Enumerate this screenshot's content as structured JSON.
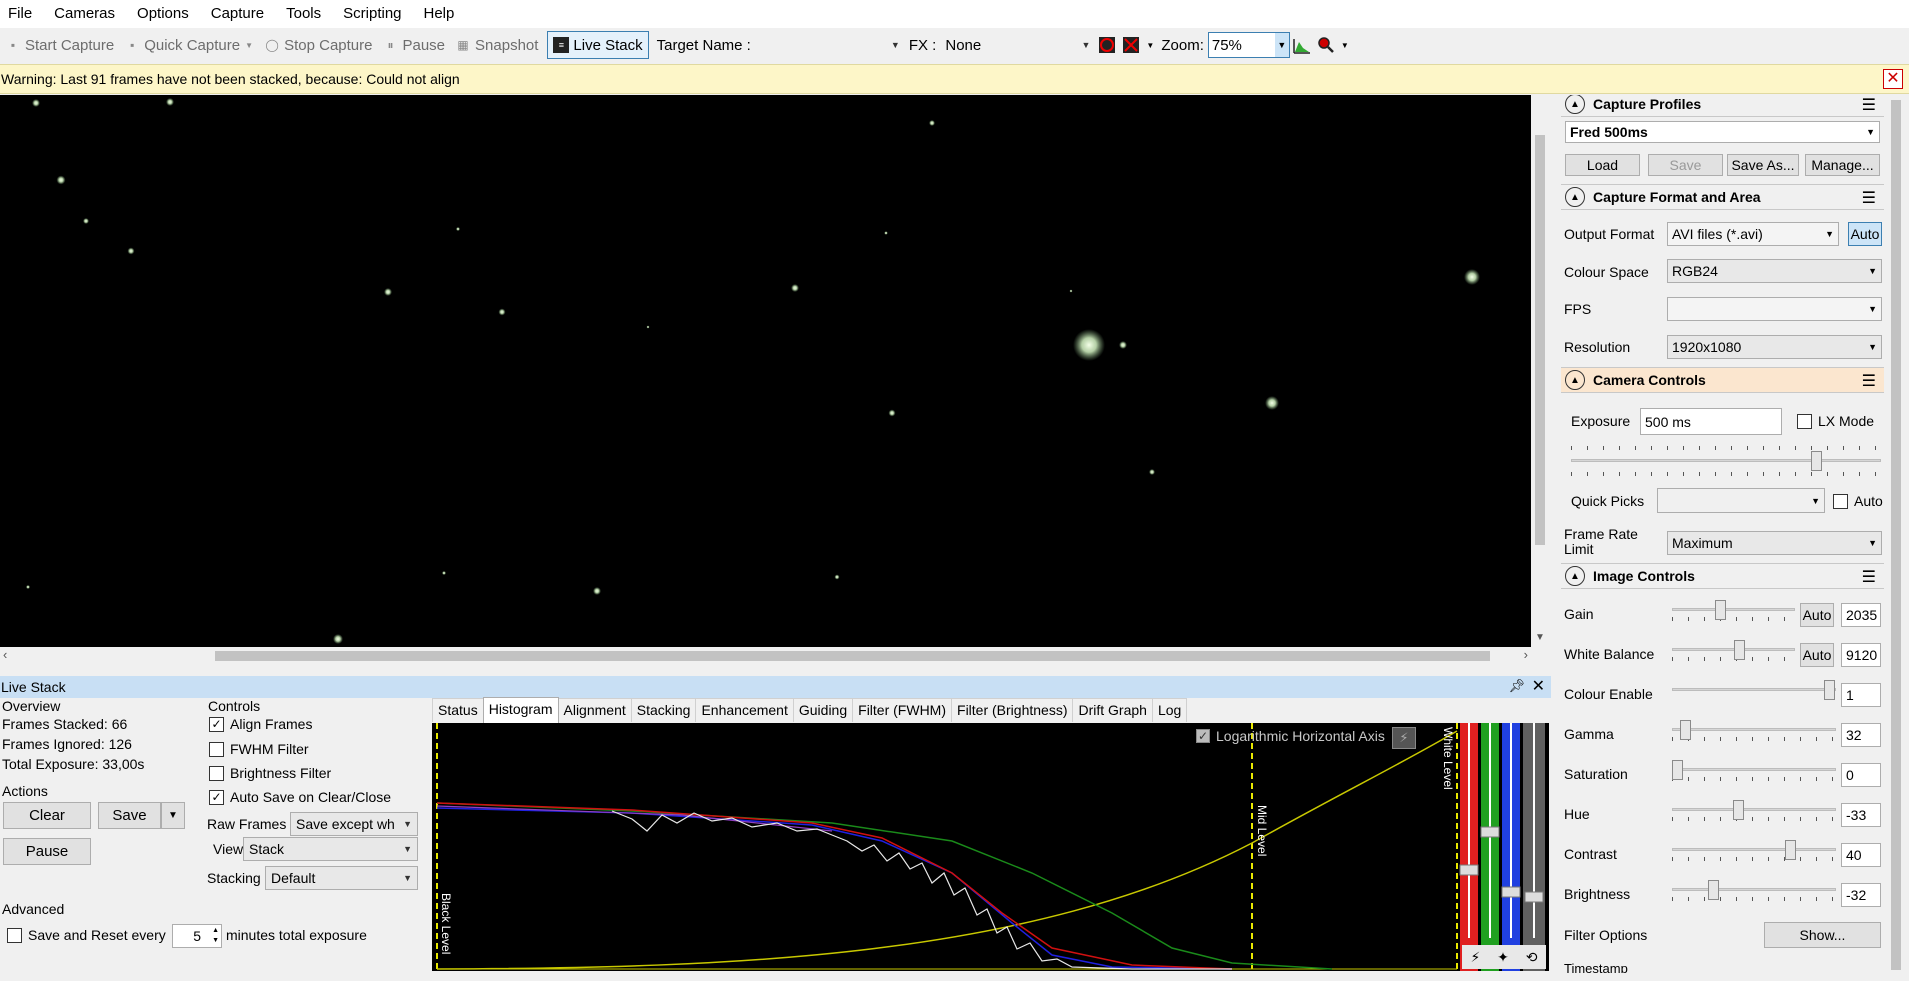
{
  "menu": [
    "File",
    "Cameras",
    "Options",
    "Capture",
    "Tools",
    "Scripting",
    "Help"
  ],
  "toolbar": {
    "start_capture": "Start Capture",
    "quick_capture": "Quick Capture",
    "stop_capture": "Stop Capture",
    "pause": "Pause",
    "snapshot": "Snapshot",
    "live_stack": "Live Stack",
    "target_name_label": "Target Name :",
    "target_name_value": "",
    "fx_label": "FX :",
    "fx_value": "None",
    "zoom_label": "Zoom:",
    "zoom_value": "75%"
  },
  "warning": {
    "text": "Warning: Last 91 frames have not been stacked, because: Could not align"
  },
  "live_stack": {
    "title": "Live Stack",
    "overview": {
      "title": "Overview",
      "frames_stacked": "Frames Stacked: 66",
      "frames_ignored": "Frames Ignored:  126",
      "total_exposure": "Total Exposure:  33,00s"
    },
    "actions": {
      "title": "Actions",
      "clear": "Clear",
      "save": "Save",
      "pause": "Pause"
    },
    "controls": {
      "title": "Controls",
      "align_frames": "Align Frames",
      "fwhm_filter": "FWHM Filter",
      "brightness_filter": "Brightness Filter",
      "auto_save": "Auto Save on Clear/Close",
      "raw_frames_label": "Raw Frames",
      "raw_frames_value": "Save except wh",
      "view_label": "View",
      "view_value": "Stack",
      "stacking_label": "Stacking",
      "stacking_value": "Default"
    },
    "advanced": {
      "title": "Advanced",
      "save_reset_label": "Save and Reset every",
      "save_reset_value": "5",
      "save_reset_suffix": "minutes total exposure"
    },
    "tabs": [
      "Status",
      "Histogram",
      "Alignment",
      "Stacking",
      "Enhancement",
      "Guiding",
      "Filter (FWHM)",
      "Filter (Brightness)",
      "Drift Graph",
      "Log"
    ],
    "selected_tab": "Histogram",
    "histogram": {
      "log_axis_label": "Logarithmic Horizontal Axis",
      "black_level": "Black Level",
      "mid_level": "Mid Level",
      "white_level": "White Level"
    }
  },
  "right_panel": {
    "capture_profiles": {
      "title": "Capture Profiles",
      "profile": "Fred 500ms",
      "load": "Load",
      "save": "Save",
      "save_as": "Save As...",
      "manage": "Manage..."
    },
    "capture_format": {
      "title": "Capture Format and Area",
      "output_format_label": "Output Format",
      "output_format_value": "AVI files (*.avi)",
      "auto": "Auto",
      "colour_space_label": "Colour Space",
      "colour_space_value": "RGB24",
      "fps_label": "FPS",
      "fps_value": "",
      "resolution_label": "Resolution",
      "resolution_value": "1920x1080"
    },
    "camera_controls": {
      "title": "Camera Controls",
      "exposure_label": "Exposure",
      "exposure_value": "500 ms",
      "lx_mode": "LX Mode",
      "quick_picks_label": "Quick Picks",
      "quick_picks_auto": "Auto",
      "frame_rate_label_1": "Frame Rate",
      "frame_rate_label_2": "Limit",
      "frame_rate_value": "Maximum"
    },
    "image_controls": {
      "title": "Image Controls",
      "auto": "Auto",
      "gain_label": "Gain",
      "gain_value": "2035",
      "white_balance_label": "White Balance",
      "white_balance_value": "9120",
      "colour_enable_label": "Colour Enable",
      "colour_enable_value": "1",
      "gamma_label": "Gamma",
      "gamma_value": "32",
      "saturation_label": "Saturation",
      "saturation_value": "0",
      "hue_label": "Hue",
      "hue_value": "-33",
      "contrast_label": "Contrast",
      "contrast_value": "40",
      "brightness_label": "Brightness",
      "brightness_value": "-32",
      "filter_options_label": "Filter Options",
      "show": "Show...",
      "timestamp_label": "Timestamp"
    }
  },
  "colors": {
    "warning_bg": "#fdf6c8",
    "panel_header": "#c8dff4",
    "histogram_bg": "#000000",
    "level_marker": "#e8e800"
  }
}
